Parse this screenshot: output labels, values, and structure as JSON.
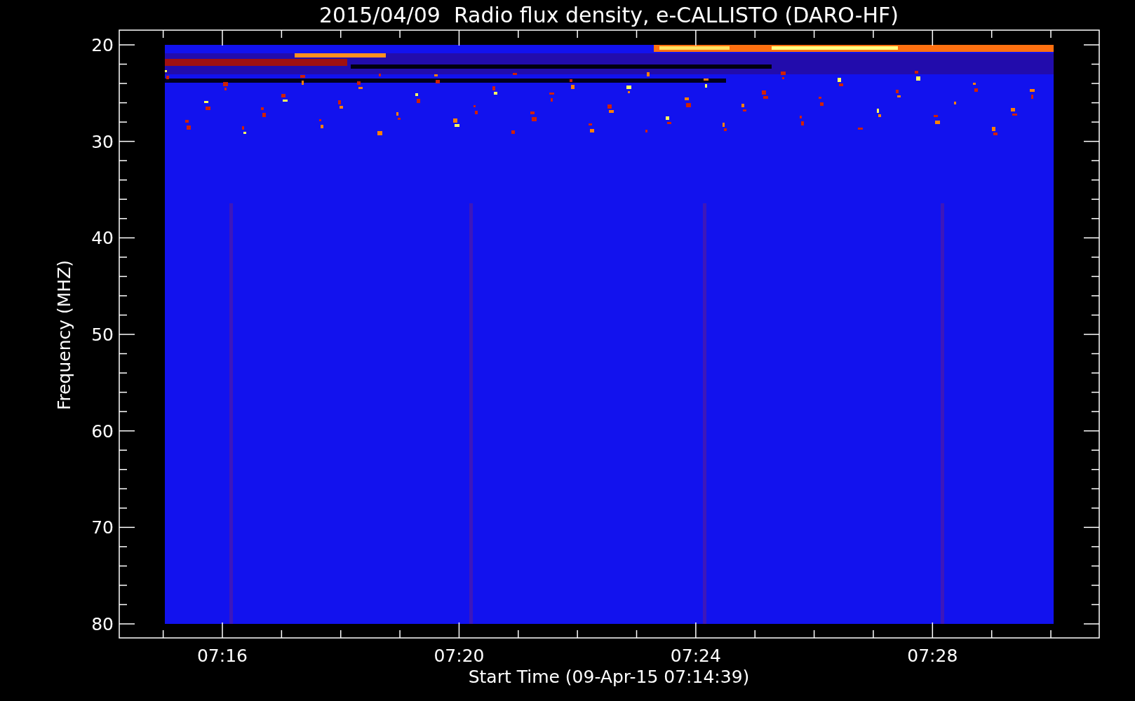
{
  "title": "2015/04/09  Radio flux density, e-CALLISTO (DARO-HF)",
  "y_axis": {
    "label": "Frequency (MHZ)",
    "ticks": [
      "20",
      "30",
      "40",
      "50",
      "60",
      "70",
      "80"
    ]
  },
  "x_axis": {
    "label": "Start Time (09-Apr-15 07:14:39)",
    "ticks": [
      "07:16",
      "07:20",
      "07:24",
      "07:28"
    ]
  }
}
